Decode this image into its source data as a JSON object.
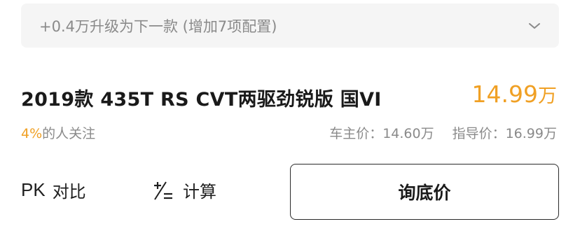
{
  "upgrade": {
    "text": "+0.4万升级为下一款 (增加7项配置)",
    "icon": "chevron-down-icon"
  },
  "model": {
    "title": "2019款 435T RS CVT两驱劲锐版 国VI",
    "price_value": "14.99",
    "price_unit": "万",
    "attention_percent": "4%",
    "attention_label": "的人关注",
    "owner_price": "车主价：14.60万",
    "guide_price": "指导价：16.99万"
  },
  "actions": {
    "pk_mark": "PK",
    "pk_label": "对比",
    "calc_label": "计算",
    "calc_icon": "plus-minus-equals-icon",
    "inquiry_label": "询底价"
  },
  "colors": {
    "accent": "#f0a024",
    "muted": "#8a8a8a",
    "bar_bg": "#f5f5f5"
  }
}
